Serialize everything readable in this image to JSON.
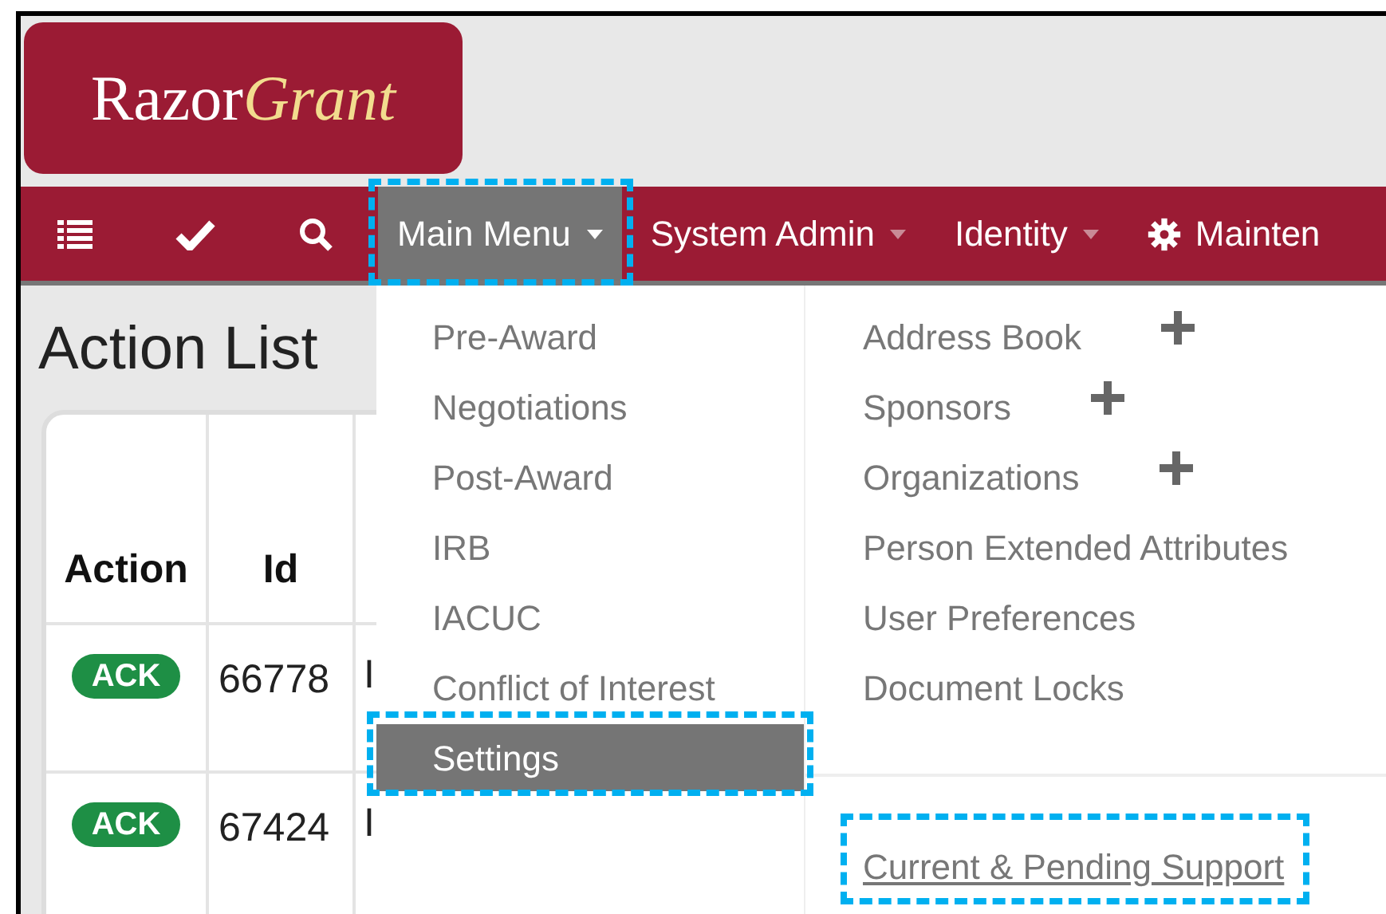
{
  "logo": {
    "text": "Razor",
    "accent": "Grant"
  },
  "nav": [
    {
      "kind": "dropdown",
      "label": "Main Menu",
      "selected": true,
      "highlighted": true
    },
    {
      "kind": "dropdown",
      "label": "System Admin",
      "selected": false,
      "highlighted": false
    },
    {
      "kind": "dropdown",
      "label": "Identity",
      "selected": false,
      "highlighted": false
    },
    {
      "kind": "gear",
      "label": "Mainten",
      "selected": false,
      "highlighted": false
    }
  ],
  "page_title": "Action List",
  "table": {
    "columns": [
      "Action",
      "Id"
    ],
    "rows": [
      {
        "action": "ACK",
        "id": "66778",
        "column_3": [
          "I"
        ]
      },
      {
        "action": "ACK",
        "id": "67424",
        "column_3": [
          "I"
        ]
      }
    ]
  },
  "main_menu": {
    "left_items": [
      {
        "label": "Pre-Award",
        "selected": false,
        "highlighted": false
      },
      {
        "label": "Negotiations",
        "selected": false,
        "highlighted": false
      },
      {
        "label": "Post-Award",
        "selected": false,
        "highlighted": false
      },
      {
        "label": "IRB",
        "selected": false,
        "highlighted": false
      },
      {
        "label": "IACUC",
        "selected": false,
        "highlighted": false
      },
      {
        "label": "Conflict of Interest",
        "selected": false,
        "highlighted": false
      },
      {
        "label": "Settings",
        "selected": true,
        "highlighted": true
      }
    ],
    "right_items": [
      {
        "label": "Address Book",
        "kind": "add"
      },
      {
        "label": "Sponsors",
        "kind": "add"
      },
      {
        "label": "Organizations",
        "kind": "add"
      },
      {
        "label": "Person Extended Attributes",
        "kind": "plain"
      },
      {
        "label": "User Preferences",
        "kind": "plain"
      },
      {
        "label": "Document Locks",
        "kind": "plain"
      }
    ],
    "link": {
      "label": "Current & Pending Support",
      "highlighted": true
    }
  }
}
